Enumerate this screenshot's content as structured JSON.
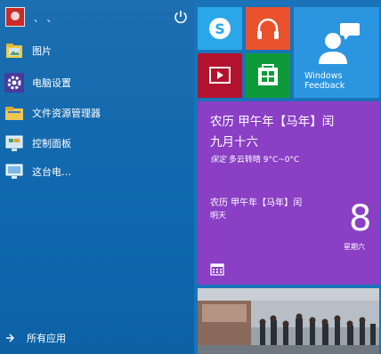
{
  "user": {
    "name": "、 、"
  },
  "menu": {
    "items": [
      {
        "label": "图片",
        "icon": "pictures-folder-icon"
      },
      {
        "label": "电脑设置",
        "icon": "settings-gear-icon"
      },
      {
        "label": "文件资源管理器",
        "icon": "file-explorer-icon"
      },
      {
        "label": "控制面板",
        "icon": "control-panel-icon"
      },
      {
        "label": "这台电…",
        "icon": "this-pc-icon"
      }
    ],
    "all_apps": "所有应用"
  },
  "tiles": {
    "feedback": {
      "line1": "Windows",
      "line2": "Feedback"
    },
    "calendar": {
      "title_line1": "农历 甲午年【马年】闰",
      "title_line2": "九月十六",
      "weather_tag": "保定",
      "weather_text": "多云转晴 9°C~0°C",
      "small_line": "农历 甲午年【马年】闰",
      "tomorrow": "明天",
      "day_number": "8",
      "weekday": "星期六"
    }
  },
  "colors": {
    "background": "#1a73b8",
    "skype": "#2aa7e8",
    "music": "#e9522d",
    "video": "#b3122e",
    "store": "#0f9a3a",
    "feedback": "#2b95e0",
    "calendar": "#8a3fc5"
  }
}
